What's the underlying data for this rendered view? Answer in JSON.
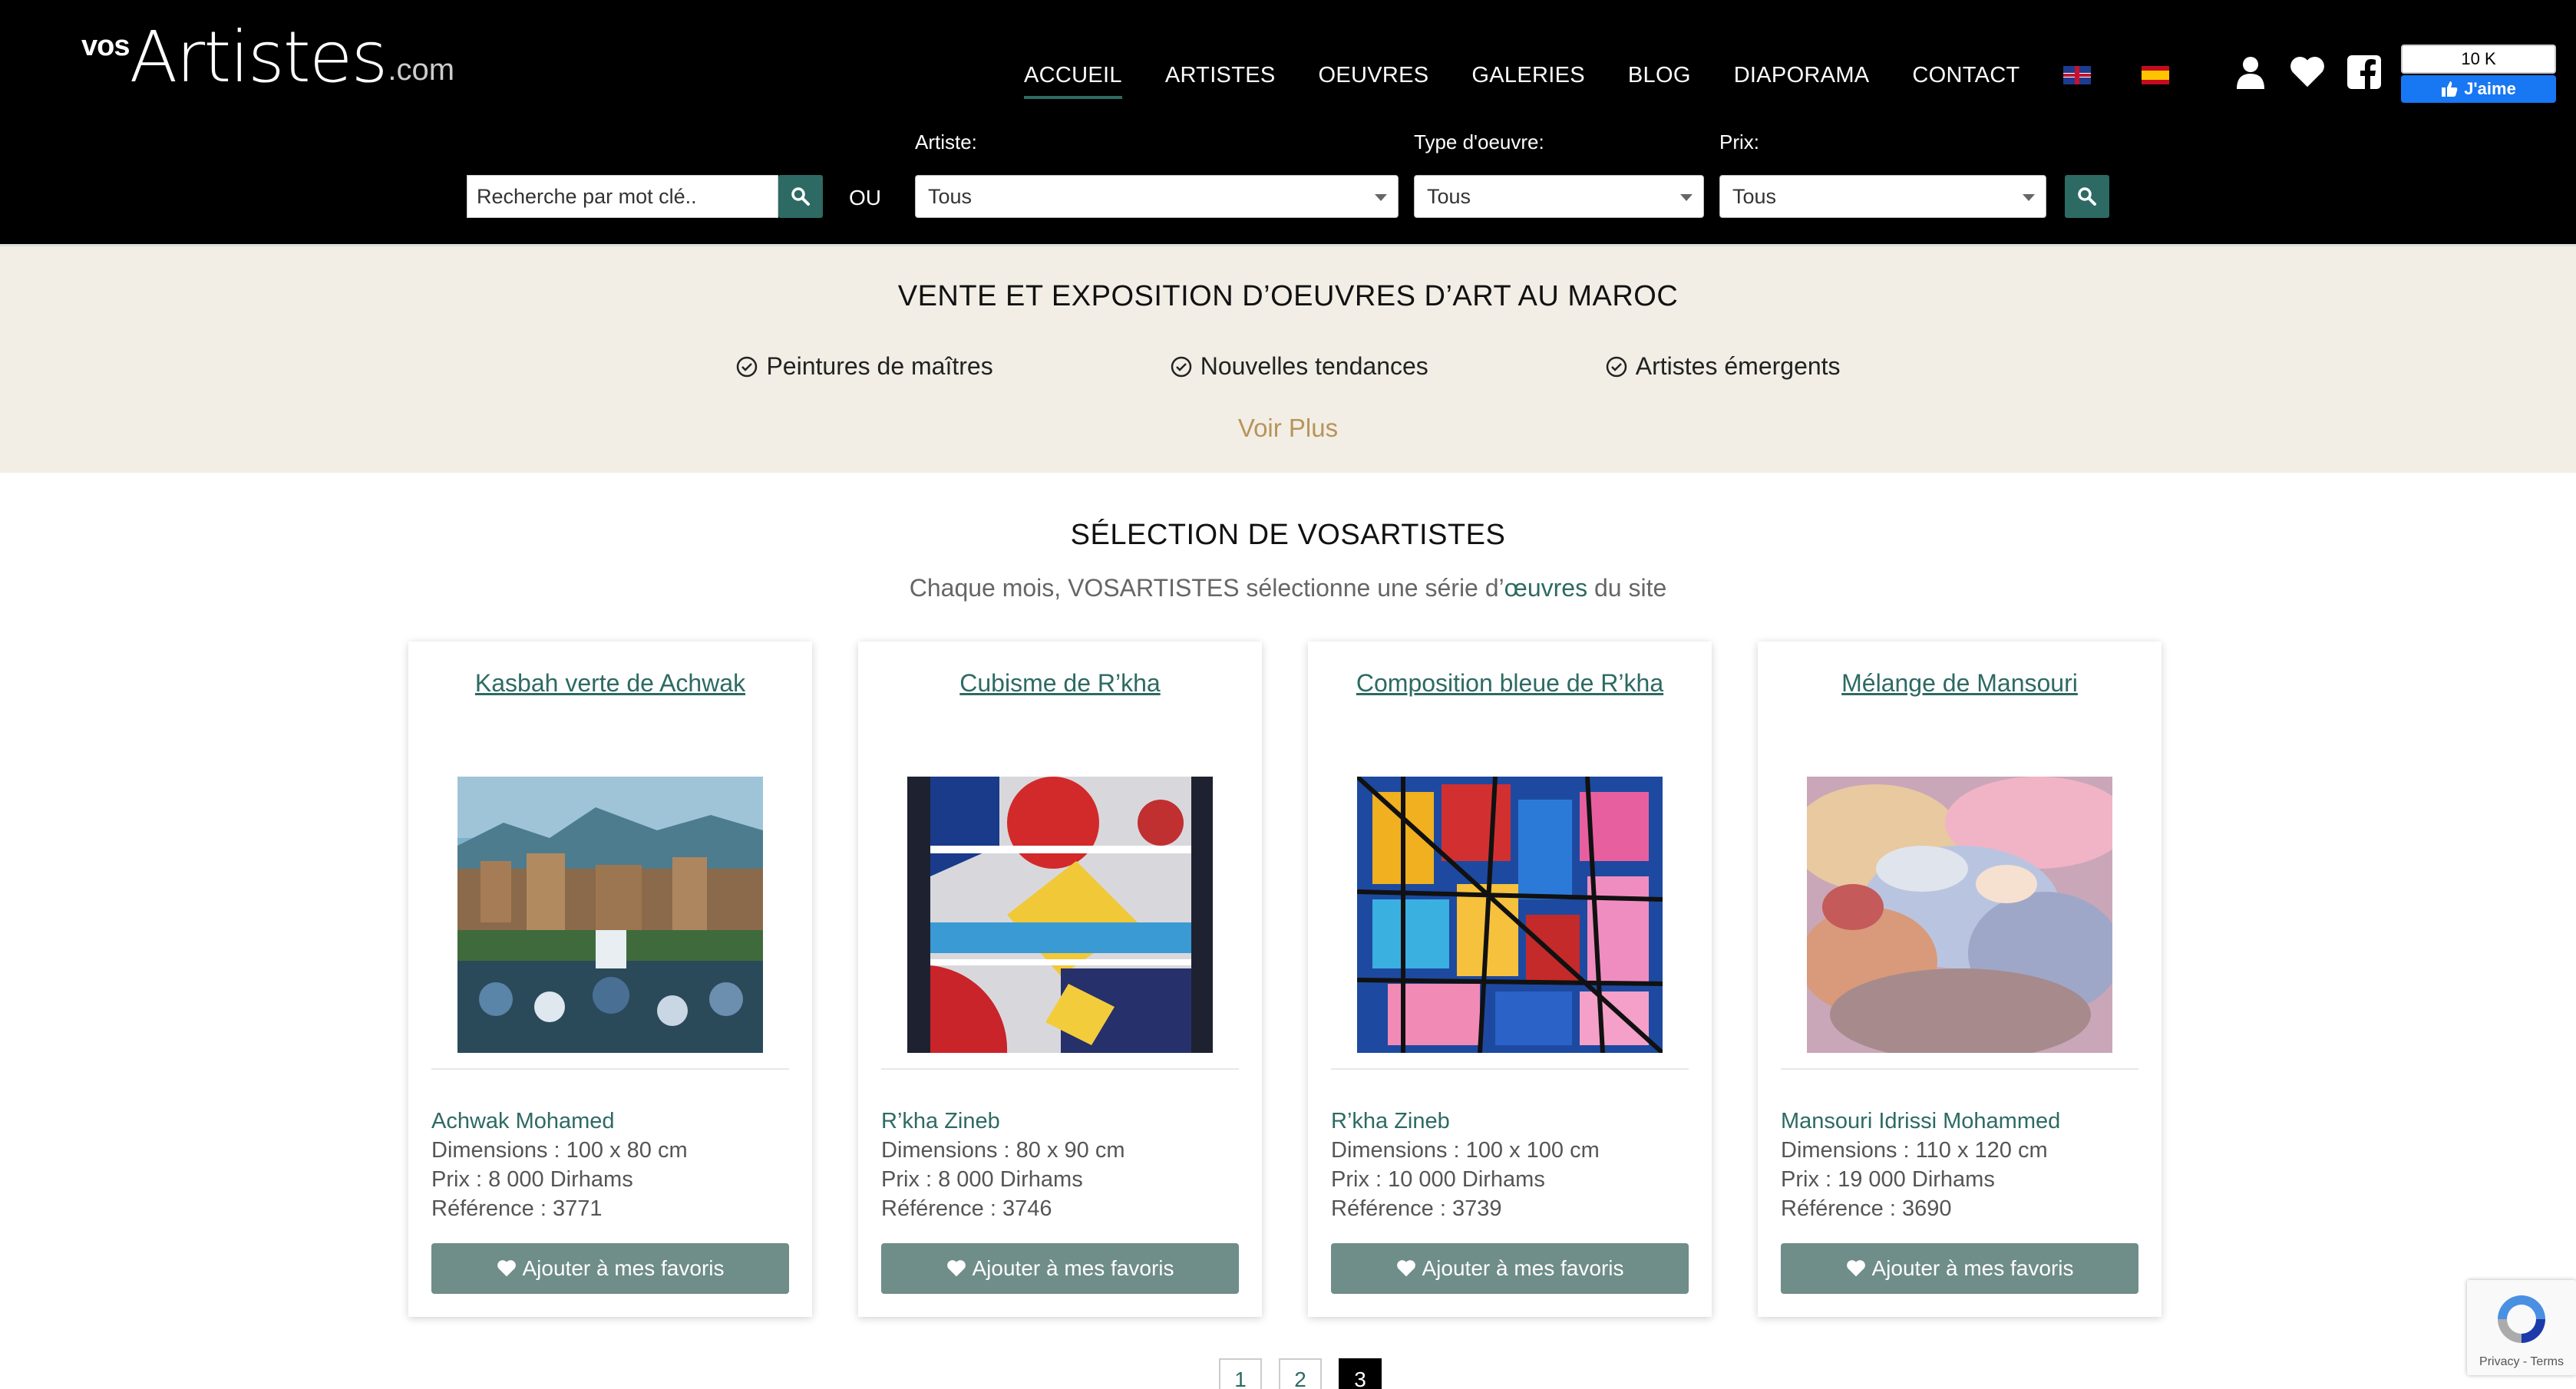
{
  "header": {
    "logo": {
      "vos": "vos",
      "artistes": "Artistes",
      "com": ".com"
    },
    "nav": [
      "ACCUEIL",
      "ARTISTES",
      "OEUVRES",
      "GALERIES",
      "BLOG",
      "DIAPORAMA",
      "CONTACT"
    ],
    "fb": {
      "count": "10 K",
      "like": "J'aime"
    }
  },
  "search": {
    "keyword_placeholder": "Recherche par mot clé..",
    "or": "OU",
    "artist_label": "Artiste:",
    "artist_value": "Tous",
    "type_label": "Type d'oeuvre:",
    "type_value": "Tous",
    "price_label": "Prix:",
    "price_value": "Tous"
  },
  "banner": {
    "title": "VENTE ET EXPOSITION D’OEUVRES D’ART AU MAROC",
    "features": [
      "Peintures de maîtres",
      "Nouvelles tendances",
      "Artistes émergents"
    ],
    "more": "Voir Plus"
  },
  "selection": {
    "title": "SÉLECTION DE VOSARTISTES",
    "subtitle_pre": "Chaque mois, VOSARTISTES sélectionne une série d’",
    "subtitle_hl": "œuvres",
    "subtitle_post": " du site",
    "cards": [
      {
        "title": "Kasbah verte de Achwak",
        "artist": "Achwak Mohamed",
        "dimensions": "Dimensions : 100 x 80 cm",
        "price": "Prix : 8 000 Dirhams",
        "ref": "Référence : 3771",
        "button": "Ajouter à mes favoris"
      },
      {
        "title": "Cubisme de R’kha",
        "artist": "R’kha Zineb",
        "dimensions": "Dimensions : 80 x 90 cm",
        "price": "Prix : 8 000 Dirhams",
        "ref": "Référence : 3746",
        "button": "Ajouter à mes favoris"
      },
      {
        "title": "Composition bleue de R’kha",
        "artist": "R’kha Zineb",
        "dimensions": "Dimensions : 100 x 100 cm",
        "price": "Prix : 10 000 Dirhams",
        "ref": "Référence : 3739",
        "button": "Ajouter à mes favoris"
      },
      {
        "title": "Mélange de Mansouri",
        "artist": "Mansouri Idrissi Mohammed",
        "dimensions": "Dimensions : 110 x 120 cm",
        "price": "Prix : 19 000 Dirhams",
        "ref": "Référence : 3690",
        "button": "Ajouter à mes favoris"
      }
    ]
  },
  "pagination": [
    "1",
    "2",
    "3"
  ],
  "recaptcha": {
    "text": "Privacy - Terms"
  }
}
